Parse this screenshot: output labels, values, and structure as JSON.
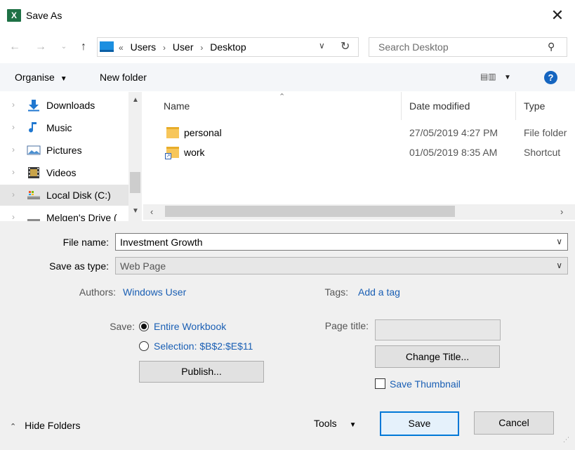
{
  "window": {
    "title": "Save As",
    "app_icon": "excel-icon",
    "close_glyph": "✕"
  },
  "address": {
    "overflow": "«",
    "path": [
      "Users",
      "User",
      "Desktop"
    ],
    "search_placeholder": "Search Desktop"
  },
  "toolbar": {
    "organise_label": "Organise",
    "new_folder_label": "New folder",
    "help_glyph": "?"
  },
  "nav": {
    "items": [
      {
        "label": "Downloads",
        "icon": "download-arrow-icon"
      },
      {
        "label": "Music",
        "icon": "music-note-icon"
      },
      {
        "label": "Pictures",
        "icon": "pictures-icon"
      },
      {
        "label": "Videos",
        "icon": "videos-icon"
      },
      {
        "label": "Local Disk (C:)",
        "icon": "local-disk-icon",
        "selected": true
      },
      {
        "label": "Melgen's Drive (",
        "icon": "network-drive-icon"
      }
    ]
  },
  "files": {
    "columns": {
      "name": "Name",
      "date": "Date modified",
      "type": "Type"
    },
    "rows": [
      {
        "name": "personal",
        "date": "27/05/2019 4:27 PM",
        "type": "File folder",
        "icon": "folder-icon"
      },
      {
        "name": "work",
        "date": "01/05/2019 8:35 AM",
        "type": "Shortcut",
        "icon": "folder-shortcut-icon"
      }
    ]
  },
  "form": {
    "file_name_label": "File name:",
    "file_name_value": "Investment Growth",
    "save_type_label": "Save as type:",
    "save_type_value": "Web Page",
    "authors_label": "Authors:",
    "authors_value": "Windows User",
    "tags_label": "Tags:",
    "tags_value": "Add a tag",
    "save_label": "Save:",
    "option_entire": "Entire Workbook",
    "option_selection": "Selection: $B$2:$E$11",
    "publish_label": "Publish...",
    "page_title_label": "Page title:",
    "page_title_value": "",
    "change_title_label": "Change Title...",
    "save_thumbnail_label": "Save Thumbnail",
    "save_thumbnail_checked": false
  },
  "footer": {
    "hide_folders_label": "Hide Folders",
    "tools_label": "Tools",
    "save_button": "Save",
    "cancel_button": "Cancel"
  }
}
